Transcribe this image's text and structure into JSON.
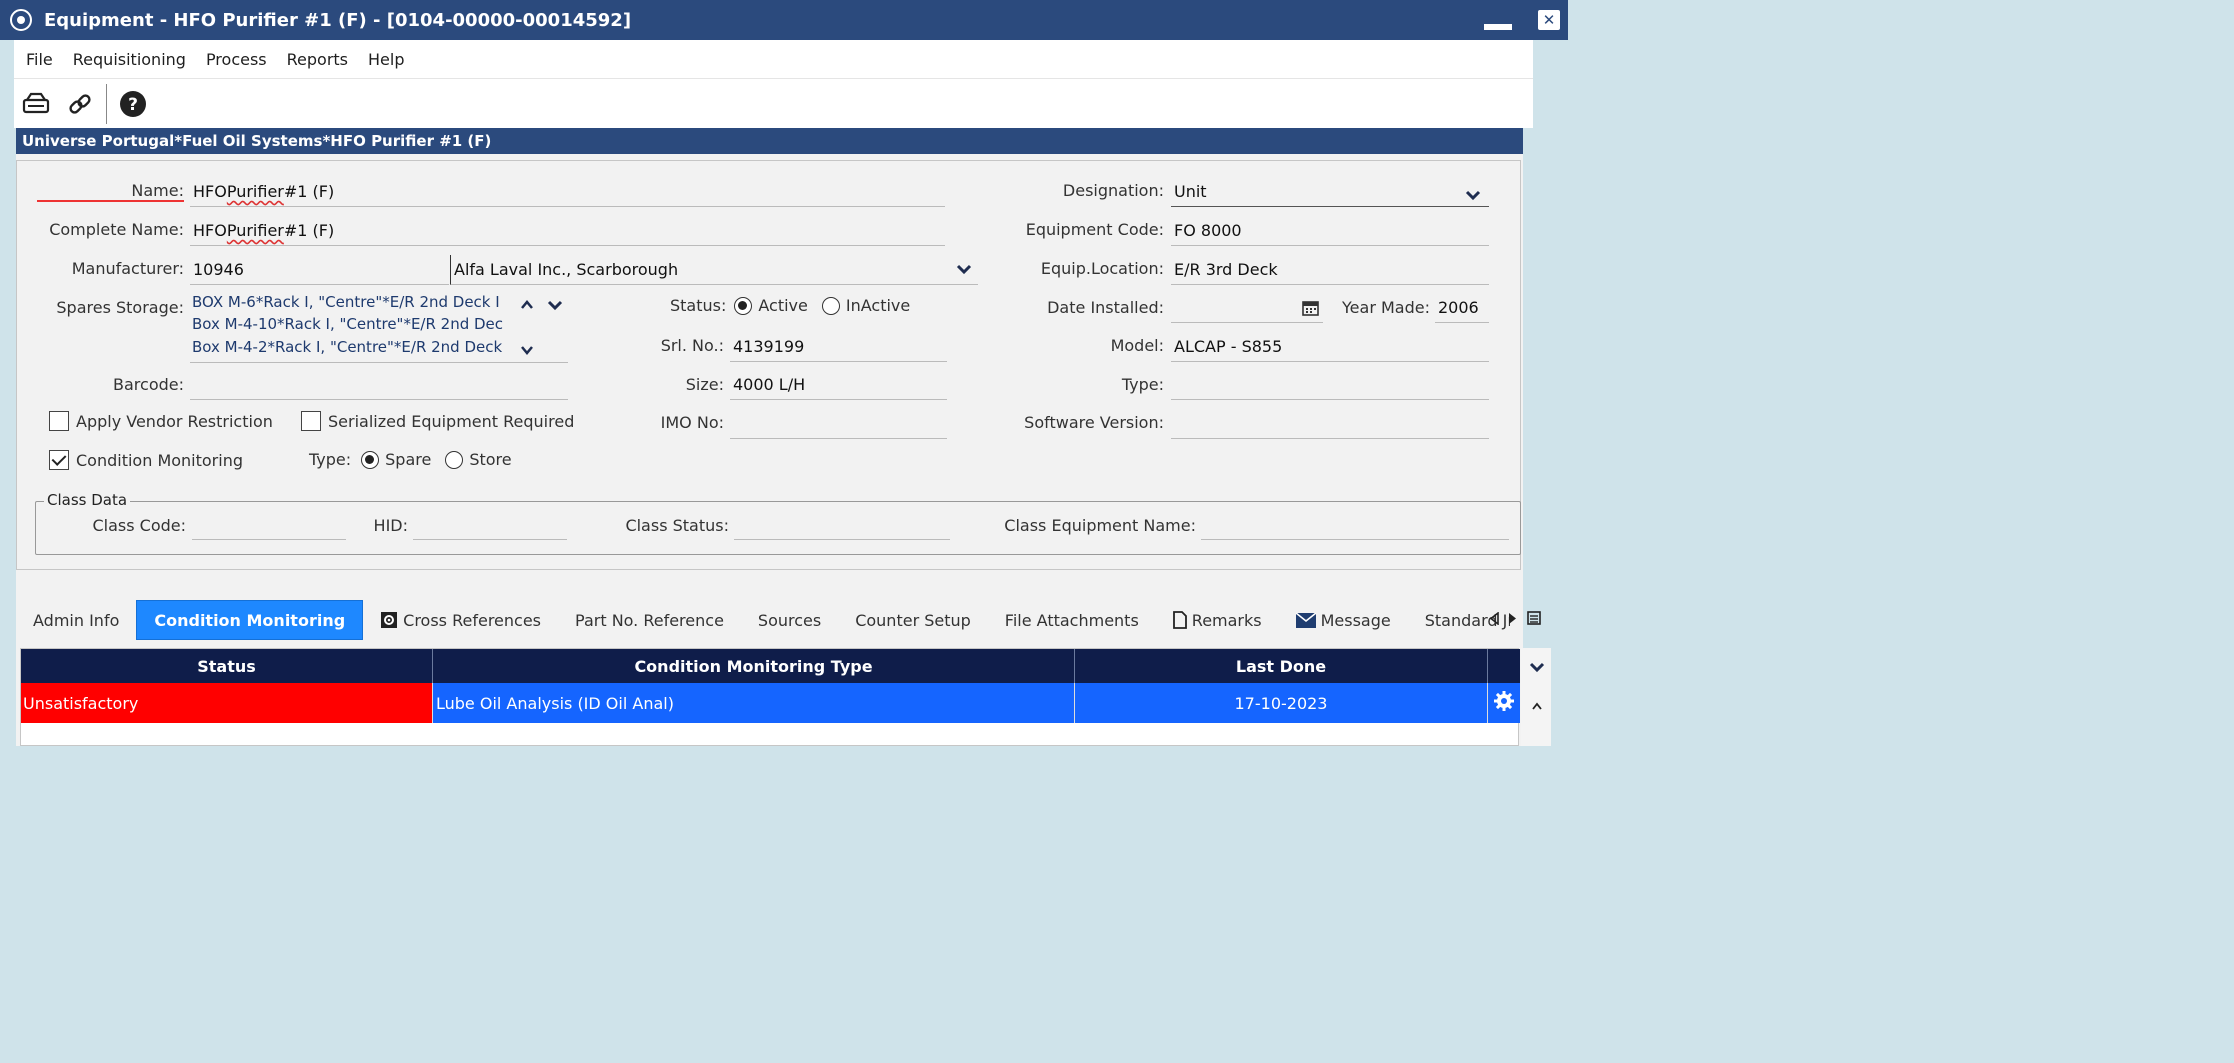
{
  "window": {
    "title": "Equipment - HFO Purifier #1 (F) - [0104-00000-00014592]",
    "close_glyph": "✕"
  },
  "menu": [
    "File",
    "Requisitioning",
    "Process",
    "Reports",
    "Help"
  ],
  "toolbar": {
    "icons": [
      "drive-icon",
      "link-icon",
      "help-icon"
    ]
  },
  "path": "Universe Portugal*Fuel Oil Systems*HFO Purifier #1 (F)",
  "form": {
    "name_label": "Name:",
    "name_value_prefix": "HFO ",
    "name_value_word": "Purifier",
    "name_value_suffix": " #1 (F)",
    "complete_name_label": "Complete Name:",
    "complete_name_prefix": "HFO ",
    "complete_name_word": "Purifier",
    "complete_name_suffix": " #1 (F)",
    "manufacturer_label": "Manufacturer:",
    "manufacturer_code": "10946",
    "manufacturer_name": "Alfa Laval Inc., Scarborough",
    "spares_label": "Spares Storage:",
    "spares_items": [
      "BOX M-6*Rack I, \"Centre\"*E/R 2nd Deck I",
      "Box M-4-10*Rack I, \"Centre\"*E/R 2nd Dec",
      "Box M-4-2*Rack I, \"Centre\"*E/R 2nd Deck"
    ],
    "barcode_label": "Barcode:",
    "barcode_value": "",
    "apply_vendor_label": "Apply Vendor Restriction",
    "apply_vendor_checked": false,
    "serialized_label": "Serialized Equipment Required",
    "serialized_checked": false,
    "condition_label": "Condition Monitoring",
    "condition_checked": true,
    "type_label": "Type:",
    "type_options": [
      "Spare",
      "Store"
    ],
    "type_selected": "Spare",
    "status_label": "Status:",
    "status_options": [
      "Active",
      "InActive"
    ],
    "status_selected": "Active",
    "srl_label": "Srl. No.:",
    "srl_value": "4139199",
    "size_label": "Size:",
    "size_value": "4000 L/H",
    "imo_label": "IMO No:",
    "imo_value": "",
    "designation_label": "Designation:",
    "designation_value": "Unit",
    "equip_code_label": "Equipment Code:",
    "equip_code_value": "FO 8000",
    "equip_location_label": "Equip.Location:",
    "equip_location_value": "E/R 3rd Deck",
    "date_installed_label": "Date Installed:",
    "date_installed_value": "",
    "year_made_label": "Year Made:",
    "year_made_value": "2006",
    "model_label": "Model:",
    "model_value": "ALCAP - S855",
    "type2_label": "Type:",
    "type2_value": "",
    "software_label": "Software Version:",
    "software_value": ""
  },
  "class_data": {
    "legend": "Class Data",
    "class_code_label": "Class Code:",
    "class_code_value": "",
    "hid_label": "HID:",
    "hid_value": "",
    "class_status_label": "Class Status:",
    "class_status_value": "",
    "class_equipment_name_label": "Class Equipment Name:",
    "class_equipment_name_value": ""
  },
  "tabs": [
    {
      "label": "Admin Info",
      "icon": ""
    },
    {
      "label": "Condition Monitoring",
      "icon": "",
      "active": true
    },
    {
      "label": "Cross References",
      "icon": "gear-box-icon"
    },
    {
      "label": "Part No. Reference",
      "icon": ""
    },
    {
      "label": "Sources",
      "icon": ""
    },
    {
      "label": "Counter Setup",
      "icon": ""
    },
    {
      "label": "File Attachments",
      "icon": ""
    },
    {
      "label": "Remarks",
      "icon": "document-icon"
    },
    {
      "label": "Message",
      "icon": "envelope-icon"
    },
    {
      "label": "Standard Jı",
      "icon": ""
    }
  ],
  "grid": {
    "columns": [
      "Status",
      "Condition Monitoring Type",
      "Last Done"
    ],
    "rows": [
      {
        "status": "Unsatisfactory",
        "type": "Lube Oil Analysis (ID Oil Anal)",
        "last_done": "17-10-2023"
      }
    ],
    "colors": {
      "status_bad": "#ff0000",
      "row_selected": "#1565ff",
      "header": "#0f1d4a"
    }
  }
}
